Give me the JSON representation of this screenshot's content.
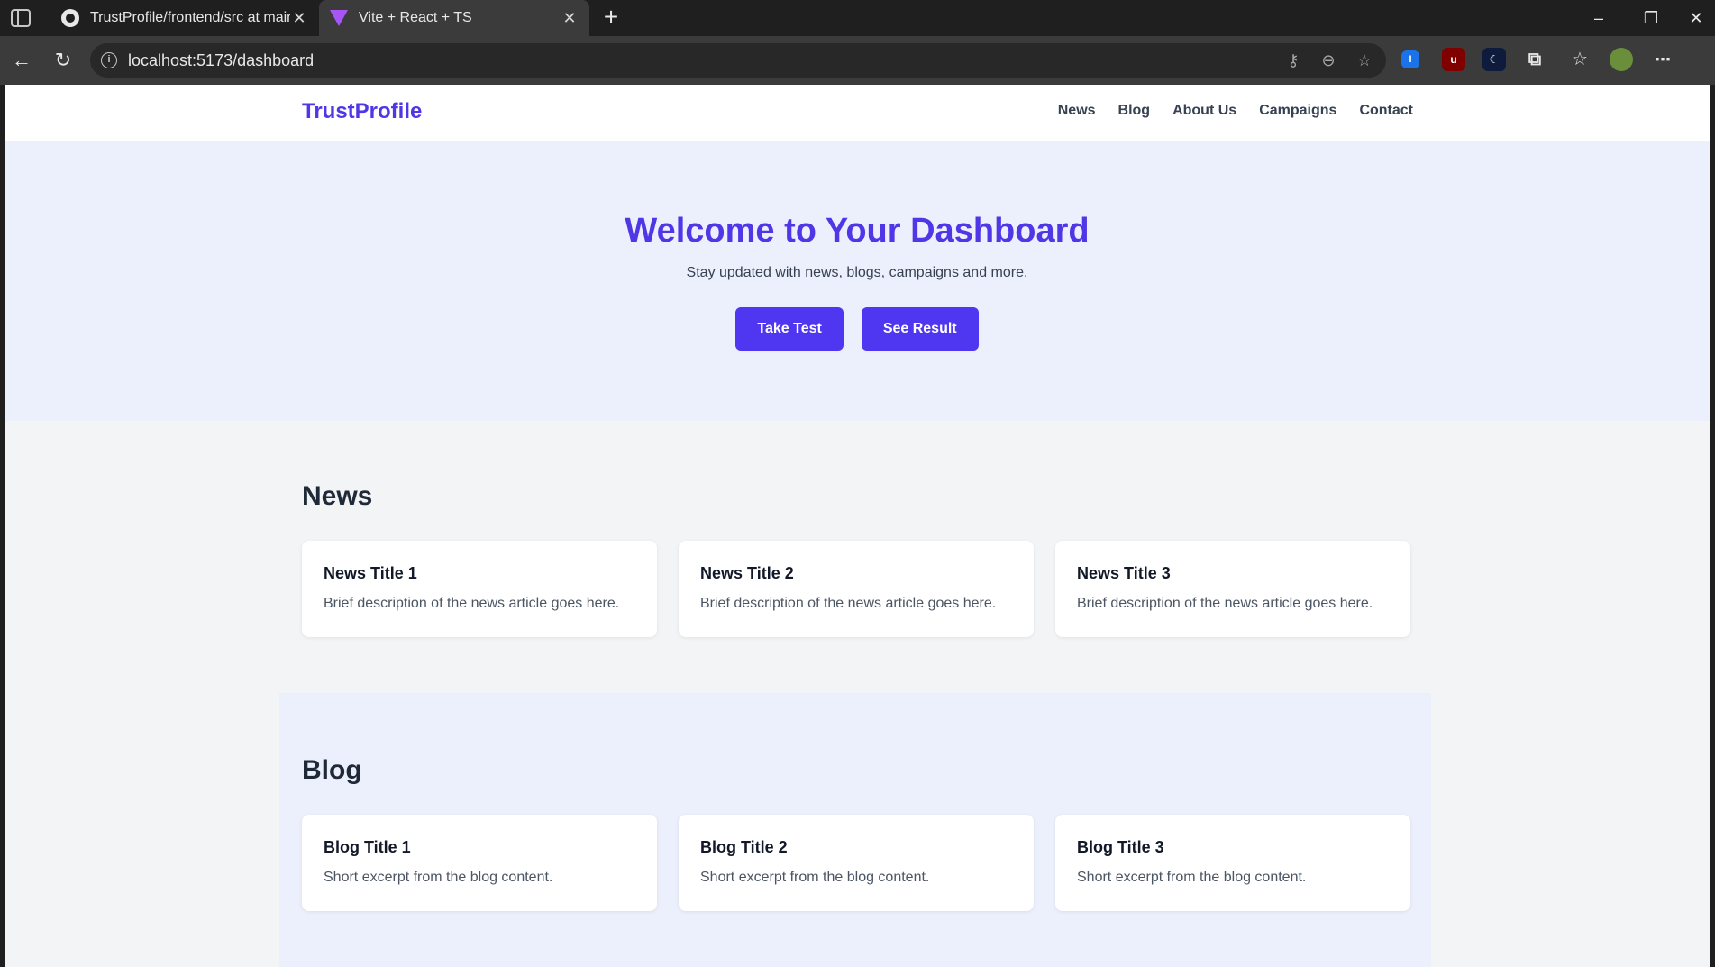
{
  "browser": {
    "tabs": [
      {
        "title": "TrustProfile/frontend/src at main",
        "active": false,
        "icon": "github-icon"
      },
      {
        "title": "Vite + React + TS",
        "active": true,
        "icon": "vite-icon"
      }
    ],
    "address": "localhost:5173/dashboard"
  },
  "site": {
    "brand": "TrustProfile",
    "nav": [
      "News",
      "Blog",
      "About Us",
      "Campaigns",
      "Contact"
    ]
  },
  "hero": {
    "title": "Welcome to Your Dashboard",
    "subtitle": "Stay updated with news, blogs, campaigns and more.",
    "buttons": [
      "Take Test",
      "See Result"
    ]
  },
  "news": {
    "heading": "News",
    "items": [
      {
        "title": "News Title 1",
        "text": "Brief description of the news article goes here."
      },
      {
        "title": "News Title 2",
        "text": "Brief description of the news article goes here."
      },
      {
        "title": "News Title 3",
        "text": "Brief description of the news article goes here."
      }
    ]
  },
  "blog": {
    "heading": "Blog",
    "items": [
      {
        "title": "Blog Title 1",
        "text": "Short excerpt from the blog content."
      },
      {
        "title": "Blog Title 2",
        "text": "Short excerpt from the blog content."
      },
      {
        "title": "Blog Title 3",
        "text": "Short excerpt from the blog content."
      }
    ]
  },
  "colors": {
    "accent": "#4f36e6",
    "hero_bg": "#ecf0fd",
    "page_bg": "#f3f4f6"
  }
}
